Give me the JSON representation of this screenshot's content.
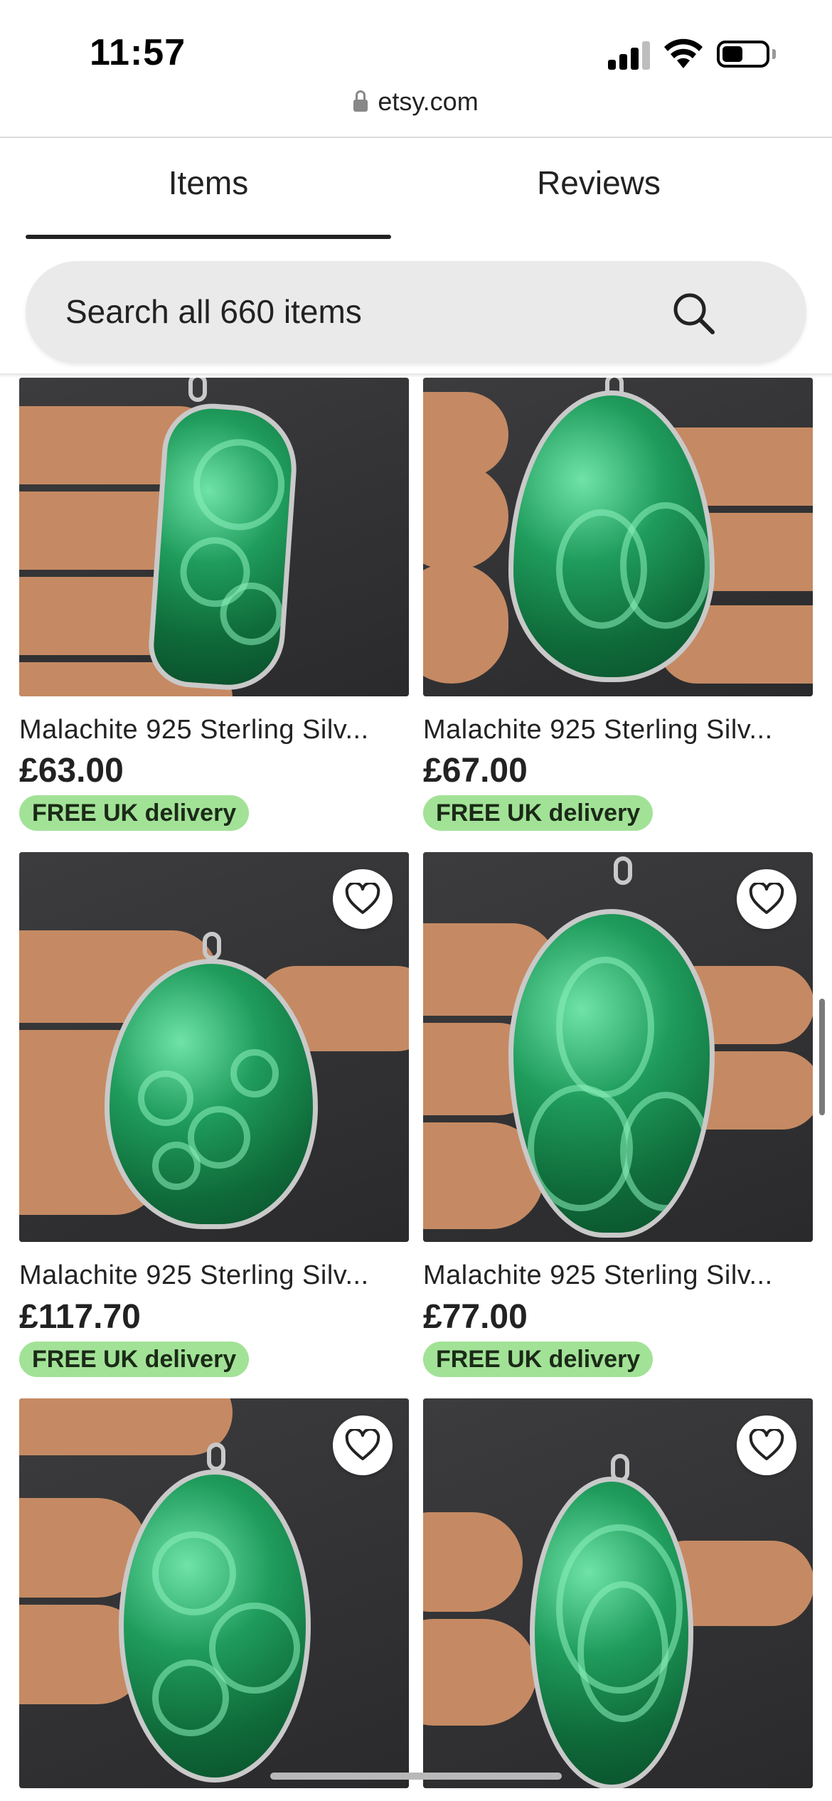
{
  "status_bar": {
    "time": "11:57"
  },
  "browser": {
    "url": "etsy.com"
  },
  "tabs": [
    {
      "label": "Items",
      "active": true
    },
    {
      "label": "Reviews",
      "active": false
    }
  ],
  "search": {
    "placeholder": "Search all 660 items"
  },
  "products": [
    {
      "title": "Malachite 925 Sterling Silv...",
      "price": "£63.00",
      "badge": "FREE UK delivery"
    },
    {
      "title": "Malachite 925 Sterling Silv...",
      "price": "£67.00",
      "badge": "FREE UK delivery"
    },
    {
      "title": "Malachite 925 Sterling Silv...",
      "price": "£117.70",
      "badge": "FREE UK delivery"
    },
    {
      "title": "Malachite 925 Sterling Silv...",
      "price": "£77.00",
      "badge": "FREE UK delivery"
    },
    {
      "title": "",
      "price": "",
      "badge": ""
    },
    {
      "title": "",
      "price": "",
      "badge": ""
    }
  ],
  "colors": {
    "badge_bg": "#a2e297",
    "text": "#222222",
    "stone": "#1f9c5c"
  },
  "icons": [
    "signal-icon",
    "wifi-icon",
    "battery-icon",
    "lock-icon",
    "search-icon",
    "heart-icon"
  ]
}
